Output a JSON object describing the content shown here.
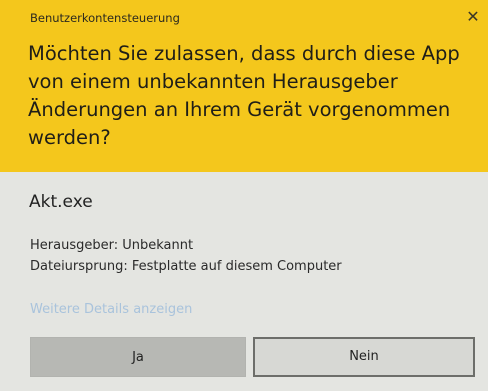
{
  "dialog": {
    "window_title": "Benutzerkontensteuerung",
    "close_glyph": "✕",
    "question_lines": [
      "Möchten Sie zulassen, dass durch diese App",
      "von einem unbekannten Herausgeber",
      "Änderungen an Ihrem Gerät vorgenommen",
      "werden?"
    ],
    "app_name": "Akt.exe",
    "publisher": "Herausgeber: Unbekannt",
    "origin": "Dateiursprung: Festplatte auf diesem Computer",
    "details_link": "Weitere Details anzeigen",
    "buttons": {
      "yes_label": "Ja",
      "no_label": "Nein"
    },
    "colors": {
      "header": "#f4c71c",
      "body": "#e4e5e1",
      "link": "#a9c3dc"
    },
    "icons": {
      "close": "close-icon"
    }
  }
}
